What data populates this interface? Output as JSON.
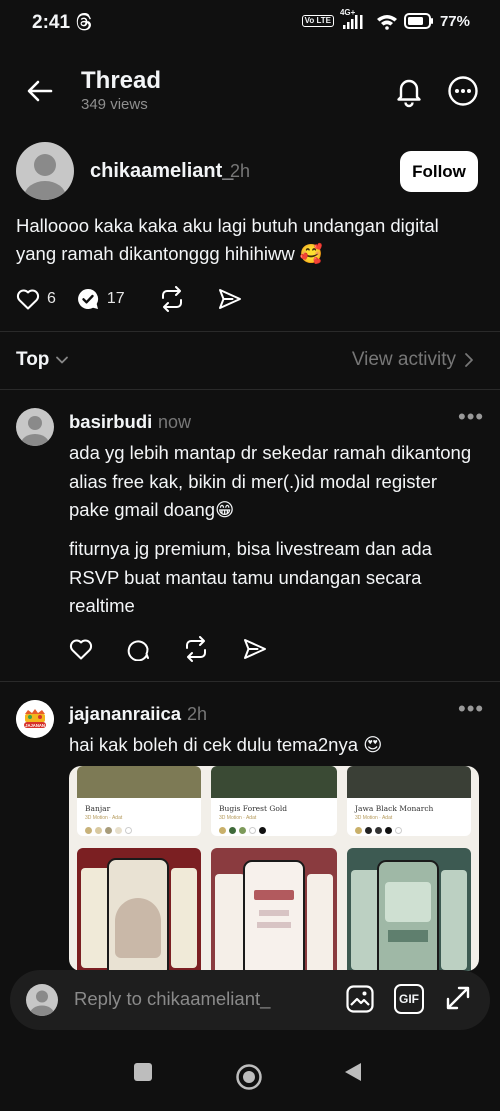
{
  "status": {
    "time": "2:41",
    "network": "4G+",
    "battery": "77%",
    "volte": "Vo LTE"
  },
  "header": {
    "title": "Thread",
    "views": "349 views"
  },
  "post": {
    "username": "chikaameliant_",
    "time": "2h",
    "follow_label": "Follow",
    "text": "Halloooo kaka kaka aku lagi butuh undangan digital yang ramah dikantonggg hihihiww 🥰",
    "likes": "6",
    "reposts": "17"
  },
  "sort": {
    "label": "Top",
    "view_activity": "View activity"
  },
  "replies": [
    {
      "username": "basirbudi",
      "time": "now",
      "paragraph1": "ada yg lebih mantap dr sekedar ramah dikantong alias free kak, bikin di mer(.)id modal register pake gmail doang😁",
      "paragraph2": "fiturnya jg premium, bisa livestream dan ada RSVP buat mantau tamu undangan secara realtime"
    },
    {
      "username": "jajananraiica",
      "time": "2h",
      "text": "hai kak boleh di cek dulu tema2nya 😍",
      "avatar_text": "JAJANAN",
      "image_cards": [
        {
          "title": "Banjar",
          "subtitle": "3D Motion · Adat"
        },
        {
          "title": "Bugis Forest Gold",
          "subtitle": "3D Motion · Adat"
        },
        {
          "title": "Jawa Black Monarch",
          "subtitle": "3D Motion · Adat"
        }
      ]
    }
  ],
  "reply_bar": {
    "placeholder": "Reply to chikaameliant_",
    "gif_label": "GIF"
  },
  "colors": {
    "background": "#101010",
    "text": "#f3f5f7",
    "muted": "#777777",
    "divider": "#2a2a2a"
  }
}
